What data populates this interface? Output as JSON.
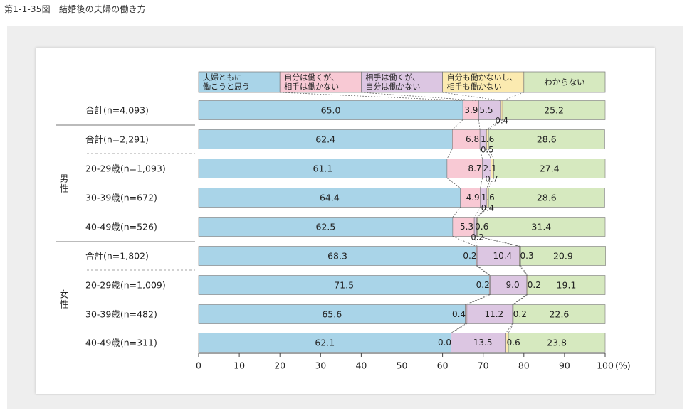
{
  "page": {
    "title": "第1-1-35図　結婚後の夫婦の働き方"
  },
  "colors": [
    "#a9d4e8",
    "#f8c9d4",
    "#dcc6e2",
    "#fbeab0",
    "#d6e9bf"
  ],
  "chart_data": {
    "type": "bar",
    "orientation": "horizontal",
    "stacked": true,
    "title": "結婚後の夫婦の働き方",
    "xlabel": "(%)",
    "xlim": [
      0,
      100
    ],
    "xticks": [
      0,
      10,
      20,
      30,
      40,
      50,
      60,
      70,
      80,
      90,
      100
    ],
    "series": [
      {
        "name": "夫婦ともに働こうと思う",
        "label_lines": [
          "夫婦ともに",
          "働こうと思う"
        ],
        "color": "#a9d4e8"
      },
      {
        "name": "自分は働くが、相手は働かない",
        "label_lines": [
          "自分は働くが、",
          "相手は働かない"
        ],
        "color": "#f8c9d4"
      },
      {
        "name": "相手は働くが、自分は働かない",
        "label_lines": [
          "相手は働くが、",
          "自分は働かない"
        ],
        "color": "#dcc6e2"
      },
      {
        "name": "自分も働かないし、相手も働かない",
        "label_lines": [
          "自分も働かないし、",
          "相手も働かない"
        ],
        "color": "#fbeab0"
      },
      {
        "name": "わからない",
        "label_lines": [
          "わからない"
        ],
        "color": "#d6e9bf"
      }
    ],
    "groups": [
      {
        "name": "",
        "rows": [
          0
        ]
      },
      {
        "name": "男性",
        "rows": [
          1,
          2,
          3,
          4
        ]
      },
      {
        "name": "女性",
        "rows": [
          5,
          6,
          7,
          8
        ]
      }
    ],
    "rows": [
      {
        "category": "合計(n=4,093)",
        "values": [
          65.0,
          3.9,
          5.5,
          0.4,
          25.2
        ]
      },
      {
        "category": "合計(n=2,291)",
        "values": [
          62.4,
          6.8,
          1.6,
          0.5,
          28.6
        ]
      },
      {
        "category": "20-29歳(n=1,093)",
        "values": [
          61.1,
          8.7,
          2.1,
          0.7,
          27.4
        ]
      },
      {
        "category": "30-39歳(n=672)",
        "values": [
          64.4,
          4.9,
          1.6,
          0.4,
          28.6
        ]
      },
      {
        "category": "40-49歳(n=526)",
        "values": [
          62.5,
          5.3,
          0.6,
          0.2,
          31.4
        ]
      },
      {
        "category": "合計(n=1,802)",
        "values": [
          68.3,
          0.2,
          10.4,
          0.3,
          20.9
        ]
      },
      {
        "category": "20-29歳(n=1,009)",
        "values": [
          71.5,
          0.2,
          9.0,
          0.2,
          19.1
        ]
      },
      {
        "category": "30-39歳(n=482)",
        "values": [
          65.6,
          0.4,
          11.2,
          0.2,
          22.6
        ]
      },
      {
        "category": "40-49歳(n=311)",
        "values": [
          62.1,
          0.0,
          13.5,
          0.6,
          23.8
        ]
      }
    ]
  }
}
